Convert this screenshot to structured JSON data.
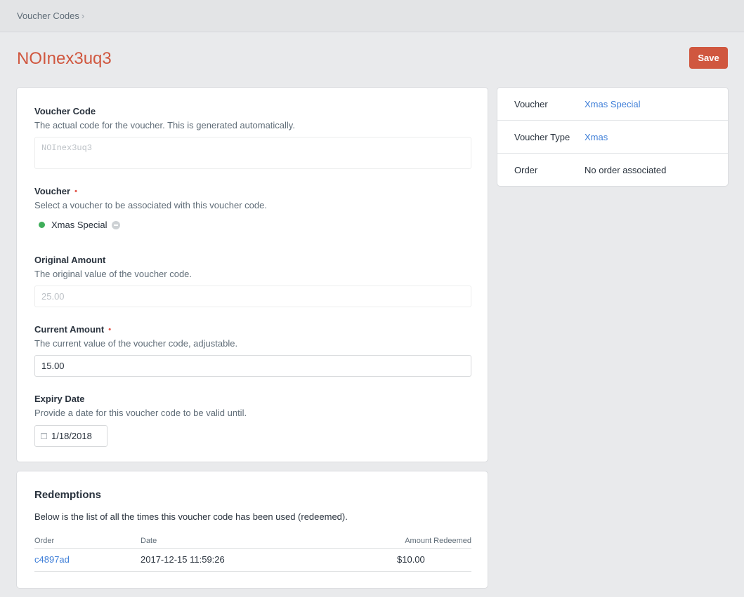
{
  "breadcrumb": {
    "label": "Voucher Codes",
    "separator": "›"
  },
  "page": {
    "title": "NOInex3uq3"
  },
  "toolbar": {
    "save_label": "Save"
  },
  "colors": {
    "accent": "#d0573f",
    "link": "#3f7fd8",
    "status_enabled": "#3fae5a",
    "required": "#e2574c"
  },
  "fields": {
    "code": {
      "label": "Voucher Code",
      "instructions": "The actual code for the voucher. This is generated automatically.",
      "value": "NOInex3uq3"
    },
    "voucher": {
      "label": "Voucher",
      "required_mark": "•",
      "instructions": "Select a voucher to be associated with this voucher code.",
      "selected": "Xmas Special"
    },
    "original_amount": {
      "label": "Original Amount",
      "instructions": "The original value of the voucher code.",
      "value": "25.00"
    },
    "current_amount": {
      "label": "Current Amount",
      "required_mark": "•",
      "instructions": "The current value of the voucher code, adjustable.",
      "value": "15.00"
    },
    "expiry": {
      "label": "Expiry Date",
      "instructions": "Provide a date for this voucher code to be valid until.",
      "value": "1/18/2018",
      "icon": "calendar-icon"
    }
  },
  "meta": {
    "rows": [
      {
        "key": "Voucher",
        "value": "Xmas Special"
      },
      {
        "key": "Voucher Type",
        "value": "Xmas"
      },
      {
        "key": "Order",
        "value": "No order associated"
      }
    ]
  },
  "redemptions": {
    "title": "Redemptions",
    "instructions": "Below is the list of all the times this voucher code has been used (redeemed).",
    "columns": [
      "Order",
      "Date",
      "Amount Redeemed"
    ],
    "rows": [
      {
        "order": "c4897ad",
        "date": "2017-12-15 11:59:26",
        "amount": "$10.00"
      }
    ]
  }
}
